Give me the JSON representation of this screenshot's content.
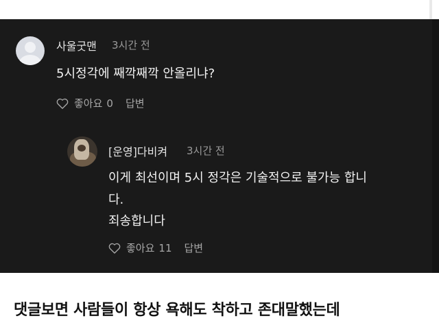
{
  "comment": {
    "author": "사울굿맨",
    "time": "3시간 전",
    "text": "5시정각에 째깍째깍 안올리냐?",
    "like_label": "좋아요",
    "like_count": "0",
    "reply_label": "답변"
  },
  "reply": {
    "author": "[운영]다비켜",
    "time": "3시간 전",
    "lines": [
      "이게 최선이며 5시 정각은 기술적으로 불가능 합니",
      "다.",
      "죄송합니다"
    ],
    "like_label": "좋아요",
    "like_count": "11",
    "reply_label": "답변"
  },
  "caption": "댓글보면 사람들이 항상 욕해도 착하고 존대말했는데",
  "icons": {
    "comment_avatar": "default-user-avatar-icon",
    "reply_avatar": "profile-photo-avatar",
    "like": "heart-outline-icon"
  },
  "colors": {
    "panel_bg": "#1a1a1a",
    "text_primary": "#f2f2f2",
    "text_secondary": "#9a9a9a"
  }
}
